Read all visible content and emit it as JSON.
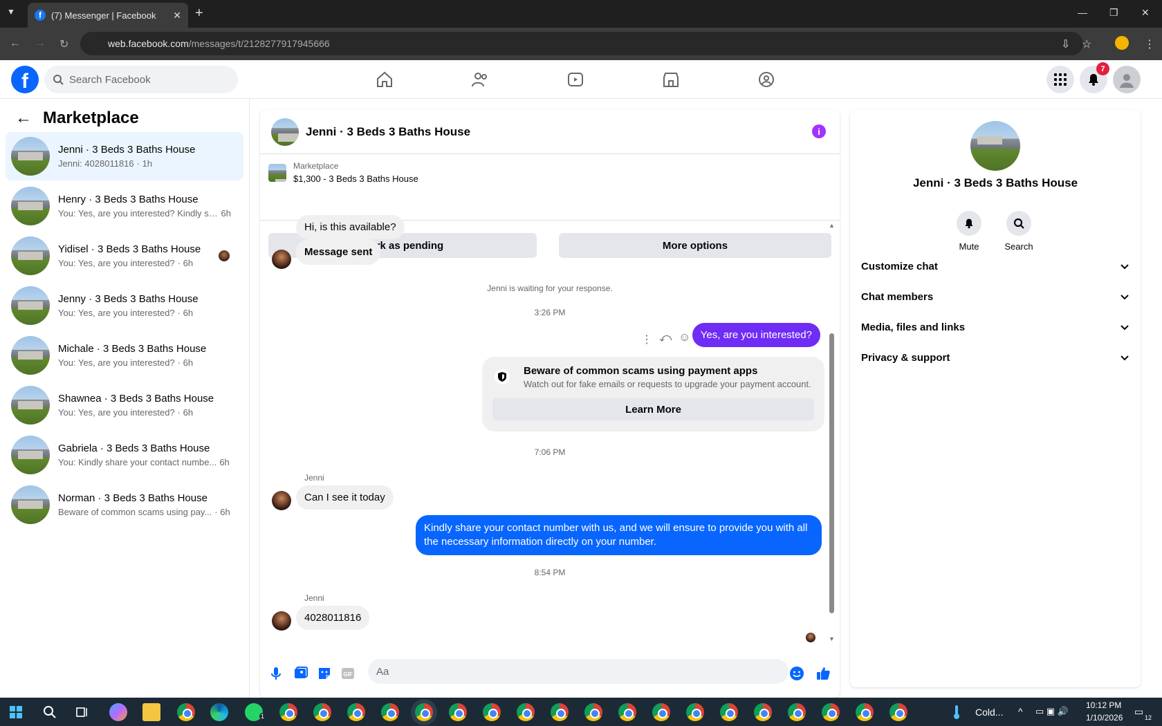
{
  "browser": {
    "tab_title": "(7) Messenger | Facebook",
    "url_host": "web.facebook.com",
    "url_path": "/messages/t/2128277917945666"
  },
  "fb_header": {
    "search_placeholder": "Search Facebook",
    "notification_count": "7"
  },
  "sidebar": {
    "title": "Marketplace",
    "conversations": [
      {
        "name": "Jenni · 3 Beds 3 Baths House",
        "preview": "Jenni: 4028011816",
        "time": "· 1h",
        "active": true
      },
      {
        "name": "Henry · 3 Beds 3 Baths House",
        "preview": "You: Yes, are you interested? Kindly sh...",
        "time": "6h"
      },
      {
        "name": "Yidisel · 3 Beds 3 Baths House",
        "preview": "You: Yes, are you interested?",
        "time": "· 6h",
        "unread": true
      },
      {
        "name": "Jenny · 3 Beds 3 Baths House",
        "preview": "You: Yes, are you interested?",
        "time": "· 6h"
      },
      {
        "name": "Michale · 3 Beds 3 Baths House",
        "preview": "You: Yes, are you interested?",
        "time": "· 6h"
      },
      {
        "name": "Shawnea · 3 Beds 3 Baths House",
        "preview": "You: Yes, are you interested?",
        "time": "· 6h"
      },
      {
        "name": "Gabriela · 3 Beds 3 Baths House",
        "preview": "You: Kindly share your contact numbe...",
        "time": "6h"
      },
      {
        "name": "Norman · 3 Beds 3 Baths House",
        "preview": "Beware of common scams using pay...",
        "time": "· 6h"
      }
    ]
  },
  "chat": {
    "title": "Jenni · 3 Beds 3 Baths House",
    "listing_label": "Marketplace",
    "listing_price": "$1,300 - 3 Beds 3 Baths House",
    "mark_pending": "Mark as pending",
    "more_options": "More options",
    "messages": {
      "first": "Hi, is this available?",
      "sent": "Message sent",
      "waiting": "Jenni is waiting for your response.",
      "time1": "3:26 PM",
      "out1": "Yes, are you interested?",
      "scam_title": "Beware of common scams using payment apps",
      "scam_body": "Watch out for fake emails or requests to upgrade your payment account.",
      "learn_more": "Learn More",
      "time2": "7:06 PM",
      "sender": "Jenni",
      "in2": "Can I see it today",
      "out2": "Kindly share your contact number with us, and we will ensure to provide you with all the necessary information directly on your number.",
      "time3": "8:54 PM",
      "in3": "4028011816"
    },
    "composer_placeholder": "Aa"
  },
  "details": {
    "name": "Jenni · 3 Beds 3 Baths House",
    "mute": "Mute",
    "search": "Search",
    "sections": [
      "Customize chat",
      "Chat members",
      "Media, files and links",
      "Privacy & support"
    ]
  },
  "taskbar": {
    "weather": "Cold...",
    "time": "10:12 PM",
    "date": "1/10/2026",
    "whatsapp_badge": "1",
    "notif_count": "12"
  },
  "colors": {
    "fb_blue": "#0866ff",
    "purple_bubble": "#6f2cf5",
    "badge_red": "#e41e3f"
  }
}
